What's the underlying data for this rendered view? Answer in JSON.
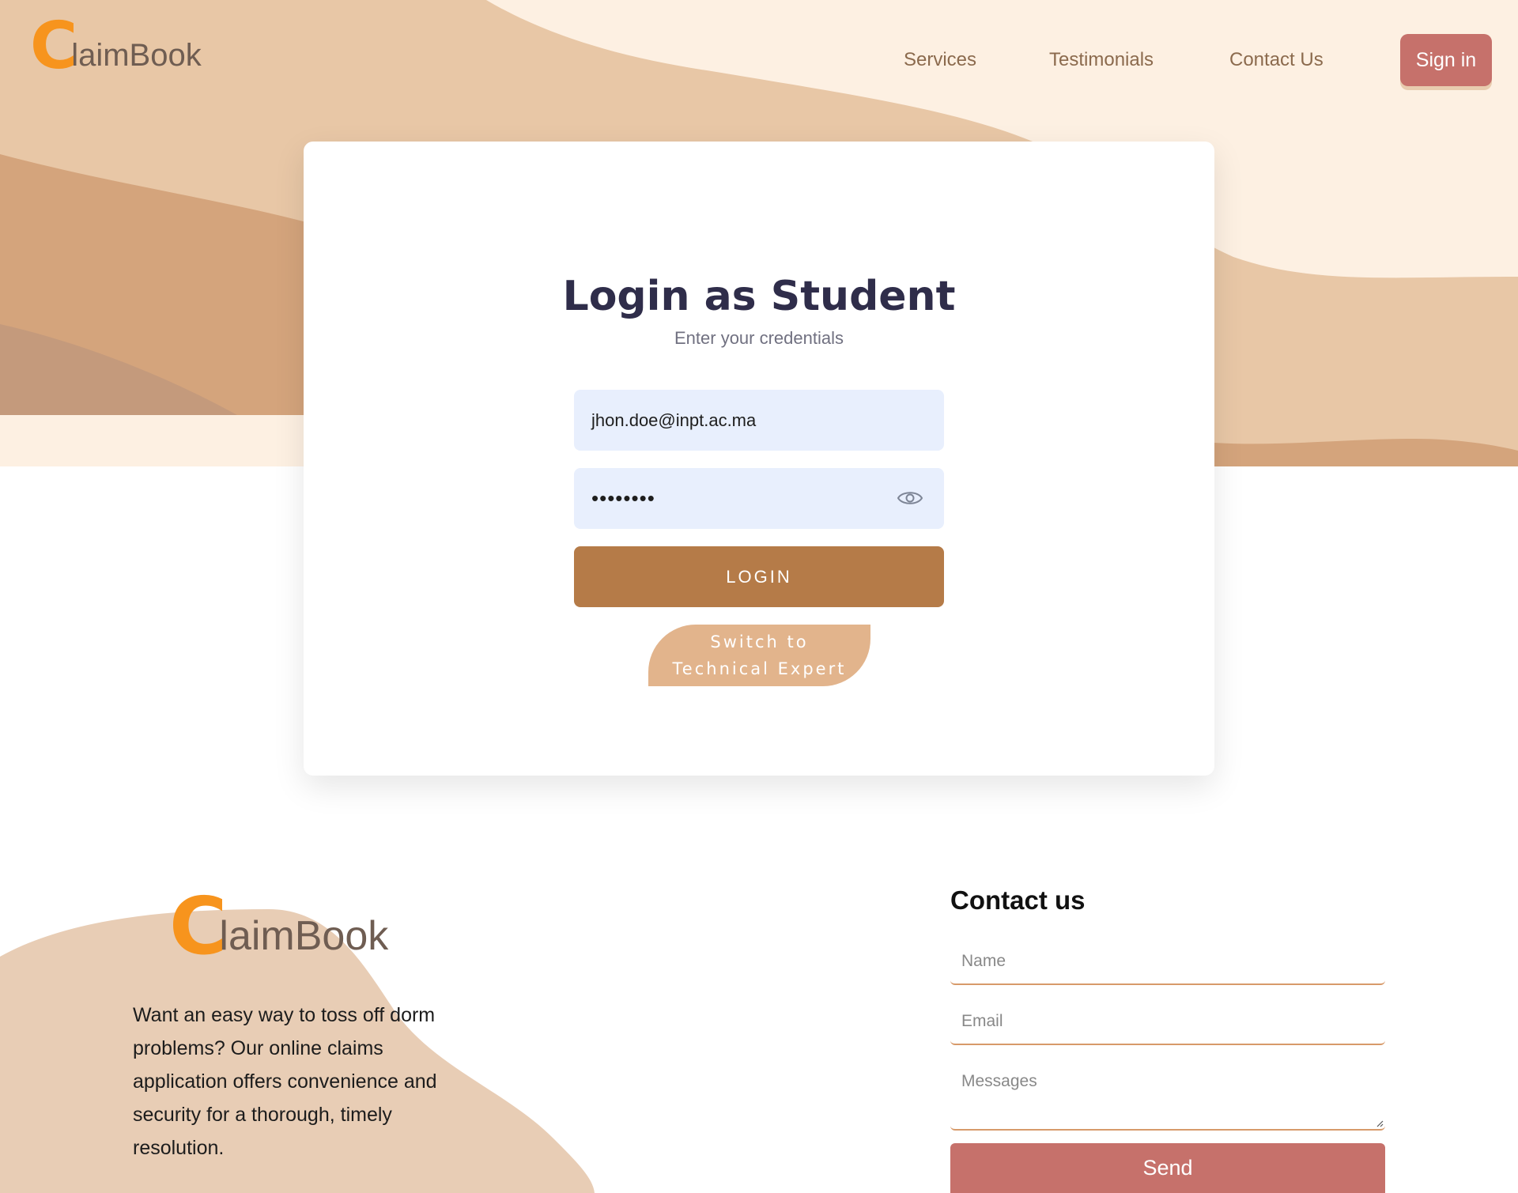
{
  "header": {
    "logo_c": "C",
    "logo_word": "laimBook",
    "nav": {
      "services": "Services",
      "testimonials": "Testimonials",
      "contact": "Contact Us"
    },
    "signin_label": "Sign in"
  },
  "login": {
    "title": "Login as Student",
    "subtitle": "Enter your credentials",
    "email_value": "jhon.doe@inpt.ac.ma",
    "password_masked": "••••••••",
    "login_label": "LOGIN",
    "switch_label": "Switch to Technical Expert"
  },
  "footer": {
    "logo_c": "C",
    "logo_word": "laimBook",
    "description": "Want an easy way to toss off dorm problems? Our online claims application offers convenience and security for a thorough, timely resolution."
  },
  "contact": {
    "title": "Contact us",
    "name_placeholder": "Name",
    "email_placeholder": "Email",
    "messages_placeholder": "Messages",
    "send_label": "Send"
  },
  "icons": {
    "password_toggle": "eye-icon"
  },
  "colors": {
    "accent_orange": "#f7941d",
    "signin_button": "#c6716b",
    "login_button": "#b57b48",
    "switch_button": "#e2b48c",
    "input_bg": "#e8effd",
    "wave_light": "#e8c7a6",
    "wave_mid": "#d4a47c",
    "wave_dark": "#c49a7c",
    "page_cream": "#fdf0e2"
  }
}
